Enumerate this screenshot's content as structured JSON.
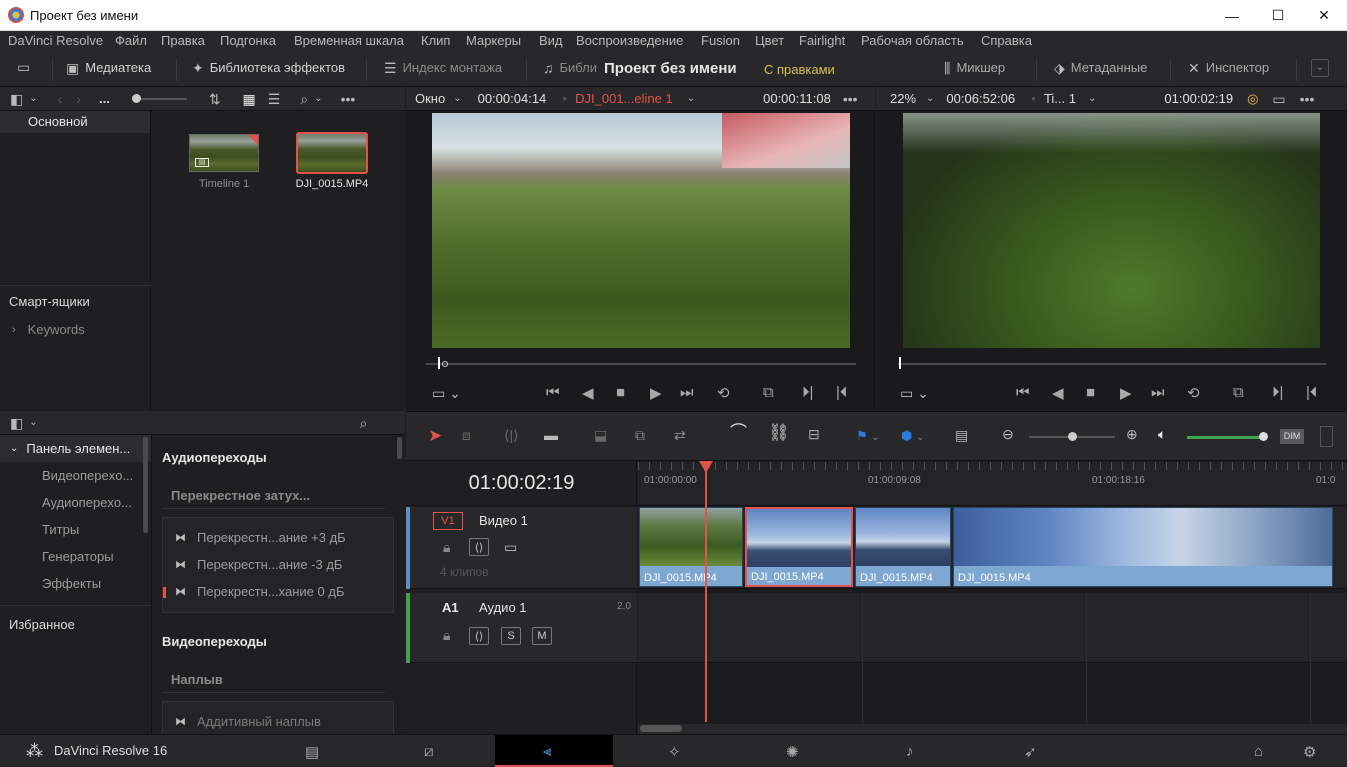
{
  "window": {
    "title": "Проект без имени",
    "min": "—",
    "max": "☐",
    "close": "✕"
  },
  "menu": [
    "DaVinci Resolve",
    "Файл",
    "Правка",
    "Подгонка",
    "Временная шкала",
    "Клип",
    "Маркеры",
    "Вид",
    "Воспроизведение",
    "Fusion",
    "Цвет",
    "Fairlight",
    "Рабочая область",
    "Справка"
  ],
  "toolbar": {
    "media": "Медиатека",
    "effects": "Библиотека эффектов",
    "edit_index": "Индекс монтажа",
    "sound_lib": "Библи",
    "project_title": "Проект без имени",
    "edited_status": "С правками",
    "mixer": "Микшер",
    "metadata": "Метаданные",
    "inspector": "Инспектор"
  },
  "media_pool": {
    "bins_dots": "...",
    "master_bin": "Основной",
    "smart_bins": "Смарт-ящики",
    "keywords": "Keywords",
    "clips": [
      {
        "name": "Timeline 1"
      },
      {
        "name": "DJI_0015.MP4"
      }
    ]
  },
  "source_viewer": {
    "mode": "Окно",
    "duration": "00:00:04:14",
    "clip_name": "DJI_001...eline 1",
    "timecode": "00:00:11:08"
  },
  "timeline_viewer": {
    "zoom": "22%",
    "duration": "00:06:52:06",
    "timeline_name": "Ti... 1",
    "timecode": "01:00:02:19"
  },
  "effects_panel": {
    "tree_root": "Панель элемен...",
    "tree_items": [
      "Видеопереxо...",
      "Аудиопереxо...",
      "Титры",
      "Генераторы",
      "Эффекты"
    ],
    "favorites": "Избранное",
    "audio_transitions_title": "Аудиопереходы",
    "crossfade_group": "Перекрестное затух...",
    "audio_items": [
      "Перекрестн...ание +3 дБ",
      "Перекрестн...ание -3 дБ",
      "Перекрестн...хание 0 дБ"
    ],
    "video_transitions_title": "Видеопереходы",
    "dissolve_group": "Наплыв",
    "video_items": [
      "Аддитивный наплыв"
    ]
  },
  "timeline": {
    "current_tc": "01:00:02:19",
    "ruler": [
      "01:00:00:00",
      "01:00:09:08",
      "01:00:18:16",
      "01:0"
    ],
    "video_track": {
      "id": "V1",
      "name": "Видео 1",
      "count": "4 клипов"
    },
    "audio_track": {
      "id": "A1",
      "name": "Аудио 1",
      "level": "2.0",
      "solo": "S",
      "mute": "M"
    },
    "clips": [
      "DJI_0015.MP4",
      "DJI_0015.MP4",
      "DJI_0015.MP4",
      "DJI_0015.MP4"
    ],
    "dim_label": "DIM",
    "volume_fraction": 0.95,
    "zoom_fraction": 0.5
  },
  "bottom_bar": {
    "app_name": "DaVinci Resolve 16"
  },
  "colors": {
    "accent_red": "#e2524a",
    "clip_blue": "#7ea8d1",
    "active_page": "#000000",
    "edited_yellow": "#d8c04a",
    "volume_green": "#3fa34d"
  }
}
